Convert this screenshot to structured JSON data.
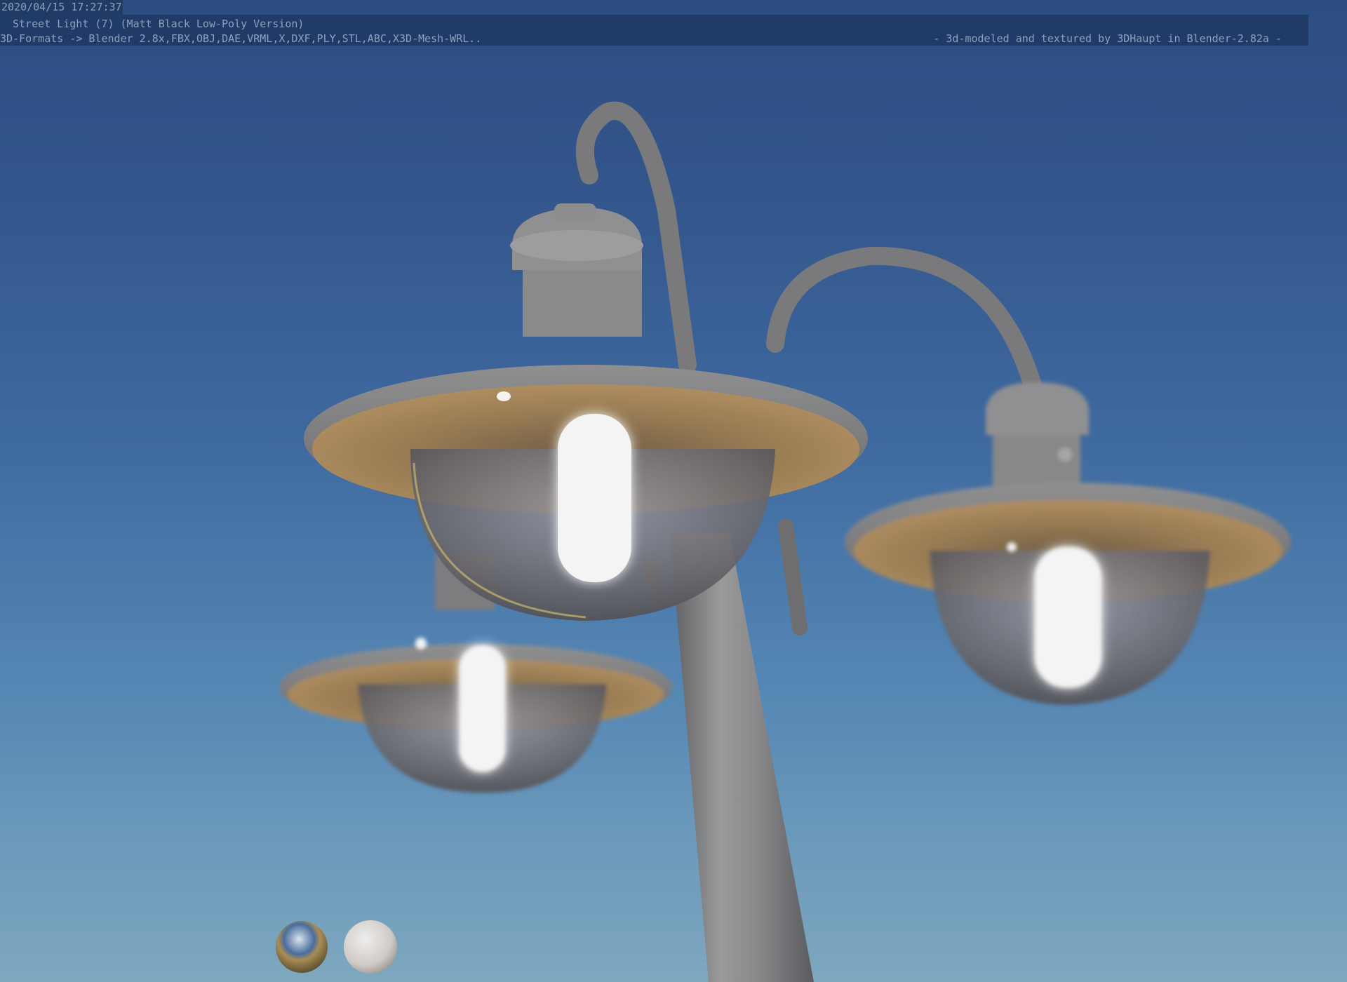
{
  "header": {
    "timestamp": "2020/04/15 17:27:37",
    "title": "Street Light (7) (Matt Black Low-Poly Version)",
    "formats": "3D-Formats -> Blender 2.8x,FBX,OBJ,DAE,VRML,X,DXF,PLY,STL,ABC,X3D-Mesh-WRL..",
    "credit": "-  3d-modeled and textured by 3DHaupt in Blender-2.82a -"
  },
  "colors": {
    "sky_top": "#2d4d82",
    "sky_bottom": "#7ea7bf",
    "metal": "#8f8f90",
    "shade_underside": "#a0835a",
    "bulb_glow": "#f4f4f4",
    "text": "#8da0bd"
  },
  "scene": {
    "subject": "street-light-3d-render",
    "lamp_count": 3,
    "preview_spheres": [
      "chrome-sphere",
      "matte-white-sphere"
    ]
  }
}
